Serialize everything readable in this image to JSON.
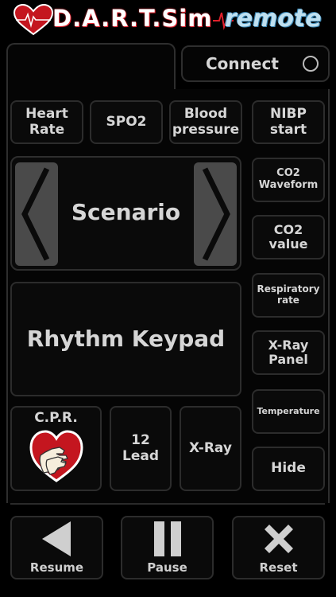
{
  "header": {
    "brand": "D.A.R.T.Sim",
    "subtitle": "remote",
    "accent_color": "#e0202c"
  },
  "connect": {
    "label": "Connect"
  },
  "top_buttons": [
    {
      "label": "Heart\nRate"
    },
    {
      "label": "SPO2"
    },
    {
      "label": "Blood\npressure"
    },
    {
      "label": "NIBP\nstart"
    }
  ],
  "scenario": {
    "label": "Scenario"
  },
  "right_buttons": [
    {
      "label": "CO2\nWaveform"
    },
    {
      "label": "CO2\nvalue"
    },
    {
      "label": "Respiratory\nrate"
    },
    {
      "label": "X-Ray\nPanel"
    },
    {
      "label": "Temperature"
    },
    {
      "label": "Hide"
    }
  ],
  "rhythm": {
    "label": "Rhythm Keypad"
  },
  "cpr": {
    "label": "C.P.R.",
    "icon": "heart-hands-icon"
  },
  "lead": {
    "label": "12 Lead"
  },
  "xray": {
    "label": "X-Ray"
  },
  "controls": {
    "resume": "Resume",
    "pause": "Pause",
    "reset": "Reset"
  }
}
